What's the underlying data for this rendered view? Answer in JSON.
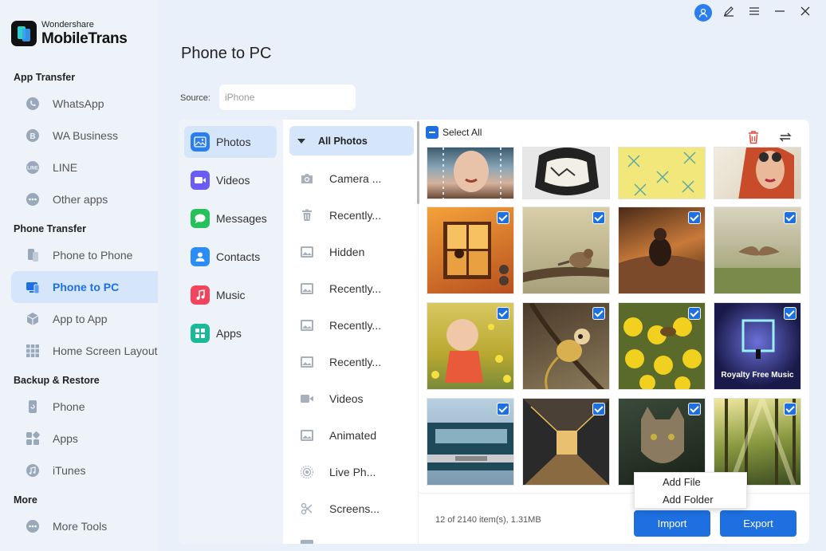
{
  "brand": {
    "top": "Wondershare",
    "main": "MobileTrans"
  },
  "sidebar": {
    "sections": [
      {
        "title": "App Transfer",
        "items": [
          {
            "label": "WhatsApp",
            "icon": "whatsapp-icon"
          },
          {
            "label": "WA Business",
            "icon": "wa-business-icon"
          },
          {
            "label": "LINE",
            "icon": "line-icon"
          },
          {
            "label": "Other apps",
            "icon": "other-apps-icon"
          }
        ]
      },
      {
        "title": "Phone Transfer",
        "items": [
          {
            "label": "Phone to Phone",
            "icon": "phone-to-phone-icon"
          },
          {
            "label": "Phone to PC",
            "icon": "phone-to-pc-icon",
            "active": true
          },
          {
            "label": "App to App",
            "icon": "app-to-app-icon"
          },
          {
            "label": "Home Screen Layout",
            "icon": "home-screen-layout-icon"
          }
        ]
      },
      {
        "title": "Backup & Restore",
        "items": [
          {
            "label": "Phone",
            "icon": "phone-backup-icon"
          },
          {
            "label": "Apps",
            "icon": "apps-backup-icon"
          },
          {
            "label": "iTunes",
            "icon": "itunes-icon"
          }
        ]
      },
      {
        "title": "More",
        "items": [
          {
            "label": "More Tools",
            "icon": "more-tools-icon"
          }
        ]
      }
    ]
  },
  "header": {
    "title": "Phone to PC"
  },
  "source": {
    "label": "Source:",
    "value": "iPhone"
  },
  "categories": [
    {
      "label": "Photos",
      "icon": "photos-icon",
      "color": "#2a7ef0",
      "active": true
    },
    {
      "label": "Videos",
      "icon": "videos-icon",
      "color": "#6a5cf5"
    },
    {
      "label": "Messages",
      "icon": "messages-icon",
      "color": "#26c15a"
    },
    {
      "label": "Contacts",
      "icon": "contacts-icon",
      "color": "#2a8cf5"
    },
    {
      "label": "Music",
      "icon": "music-icon",
      "color": "#f2445c"
    },
    {
      "label": "Apps",
      "icon": "apps-icon",
      "color": "#19b99a"
    }
  ],
  "albums": {
    "header": "All Photos",
    "items": [
      {
        "label": "Camera ...",
        "icon": "camera-icon"
      },
      {
        "label": "Recently...",
        "icon": "trash-icon"
      },
      {
        "label": "Hidden",
        "icon": "image-icon"
      },
      {
        "label": "Recently...",
        "icon": "image-icon"
      },
      {
        "label": "Recently...",
        "icon": "image-icon"
      },
      {
        "label": "Recently...",
        "icon": "image-icon"
      },
      {
        "label": "Videos",
        "icon": "video-icon"
      },
      {
        "label": "Animated",
        "icon": "image-icon"
      },
      {
        "label": "Live Ph...",
        "icon": "live-photo-icon"
      },
      {
        "label": "Screens...",
        "icon": "screenshot-icon"
      }
    ]
  },
  "grid": {
    "select_all": "Select All",
    "thumbs": [
      {
        "name": "photo-tree-bench",
        "checked": false
      },
      {
        "name": "photo-wildflowers",
        "checked": false
      },
      {
        "name": "photo-yellow-pattern",
        "checked": false
      },
      {
        "name": "photo-woman-portrait",
        "checked": false
      },
      {
        "name": "photo-orange-window",
        "checked": true
      },
      {
        "name": "photo-sparrow",
        "checked": true
      },
      {
        "name": "photo-man-sitting",
        "checked": true
      },
      {
        "name": "photo-hawk-flying",
        "checked": true
      },
      {
        "name": "photo-baby-flowers",
        "checked": true
      },
      {
        "name": "photo-squirrel-monkey",
        "checked": true
      },
      {
        "name": "photo-bee-flowers",
        "checked": true
      },
      {
        "name": "photo-royalty-free-music",
        "checked": true,
        "caption": "Royalty Free Music"
      },
      {
        "name": "photo-vintage-car",
        "checked": true
      },
      {
        "name": "photo-bridge-tunnel",
        "checked": true
      },
      {
        "name": "photo-lynx",
        "checked": true
      },
      {
        "name": "photo-forest-light",
        "checked": true
      }
    ]
  },
  "footer": {
    "count": "12 of 2140 item(s), 1.31MB",
    "import_label": "Import",
    "export_label": "Export"
  },
  "context_menu": {
    "items": [
      "Add File",
      "Add Folder"
    ]
  },
  "colors": {
    "accent": "#1e6fe0",
    "active_bg": "#d5e6fb",
    "sidebar_bg": "#eef3fa"
  }
}
